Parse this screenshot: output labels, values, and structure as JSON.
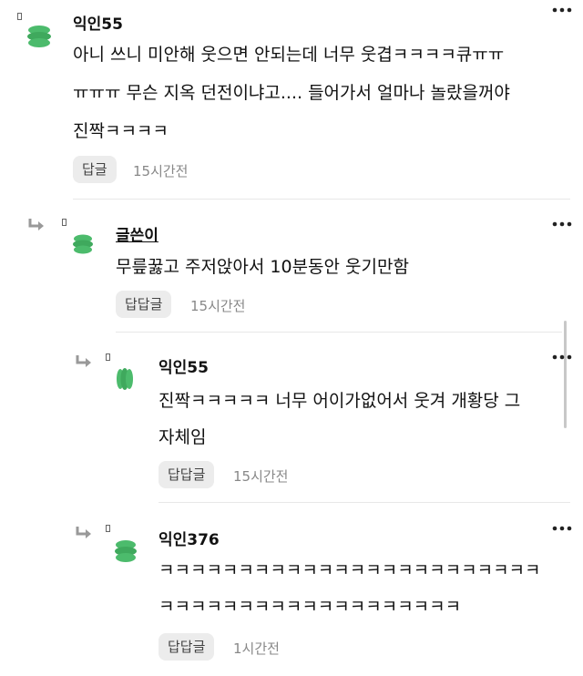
{
  "colors": {
    "avatar_green": "#4cbb6c",
    "button_bg": "#ececec",
    "time_gray": "#888888"
  },
  "icons": {
    "reply": "reply-arrow-icon",
    "more": "more-dots-icon",
    "avatar": "avatar-icon"
  },
  "comments": [
    {
      "author": "익인55",
      "lines": [
        "아니 쓰니 미안해 웃으면 안되는데 너무 웃겹ㅋㅋㅋㅋ큐ㅠㅠ",
        "ㅠㅠㅠ 무슨 지옥 던전이냐고.... 들어가서 얼마나 놀랐을꺼야",
        "진짝ㅋㅋㅋㅋ"
      ],
      "reply_label": "답글",
      "time": "15시간전"
    },
    {
      "author": "글쓴이",
      "lines": [
        "무릎꿇고 주저앉아서 10분동안 웃기만함"
      ],
      "reply_label": "답답글",
      "time": "15시간전"
    },
    {
      "author": "익인55",
      "lines": [
        "진짝ㅋㅋㅋㅋㅋ 너무 어이가없어서 웃겨 개황당 그",
        "자체임"
      ],
      "reply_label": "답답글",
      "time": "15시간전"
    },
    {
      "author": "익인376",
      "lines": [
        "ㅋㅋㅋㅋㅋㅋㅋㅋㅋㅋㅋㅋㅋㅋㅋㅋㅋㅋㅋㅋㅋㅋㅋㅋ",
        "ㅋㅋㅋㅋㅋㅋㅋㅋㅋㅋㅋㅋㅋㅋㅋㅋㅋㅋㅋ"
      ],
      "reply_label": "답답글",
      "time": "1시간전"
    }
  ]
}
